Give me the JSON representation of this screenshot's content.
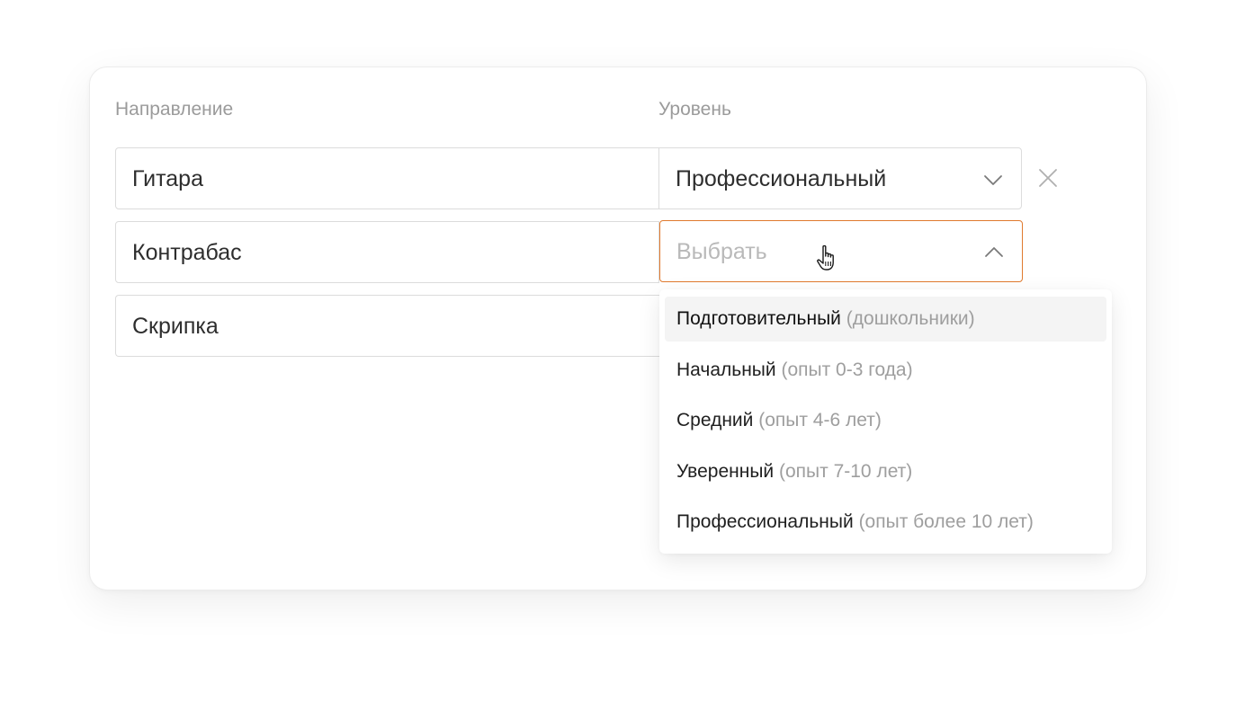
{
  "columns": {
    "direction_label": "Направление",
    "level_label": "Уровень"
  },
  "rows": [
    {
      "direction": "Гитара",
      "level": "Профессиональный",
      "level_placeholder": ""
    },
    {
      "direction": "Контрабас",
      "level": "",
      "level_placeholder": "Выбрать"
    },
    {
      "direction": "Скрипка",
      "level": "",
      "level_placeholder": ""
    }
  ],
  "dropdown": {
    "options": [
      {
        "label": "Подготовительный",
        "hint": "(дошкольники)",
        "hovered": true
      },
      {
        "label": "Начальный",
        "hint": "(опыт 0-3 года)",
        "hovered": false
      },
      {
        "label": "Средний",
        "hint": "(опыт 4-6 лет)",
        "hovered": false
      },
      {
        "label": "Уверенный",
        "hint": "(опыт 7-10 лет)",
        "hovered": false
      },
      {
        "label": "Профессиональный",
        "hint": "(опыт более 10 лет)",
        "hovered": false
      }
    ]
  },
  "colors": {
    "accent_border": "#e07a2e",
    "label_gray": "#9b9b9b",
    "hover_bg": "#f4f4f4"
  },
  "icons": {
    "row1_select": "chevron-down-icon",
    "row2_select": "chevron-up-icon",
    "remove": "close-icon",
    "cursor": "hand-pointer-icon"
  }
}
